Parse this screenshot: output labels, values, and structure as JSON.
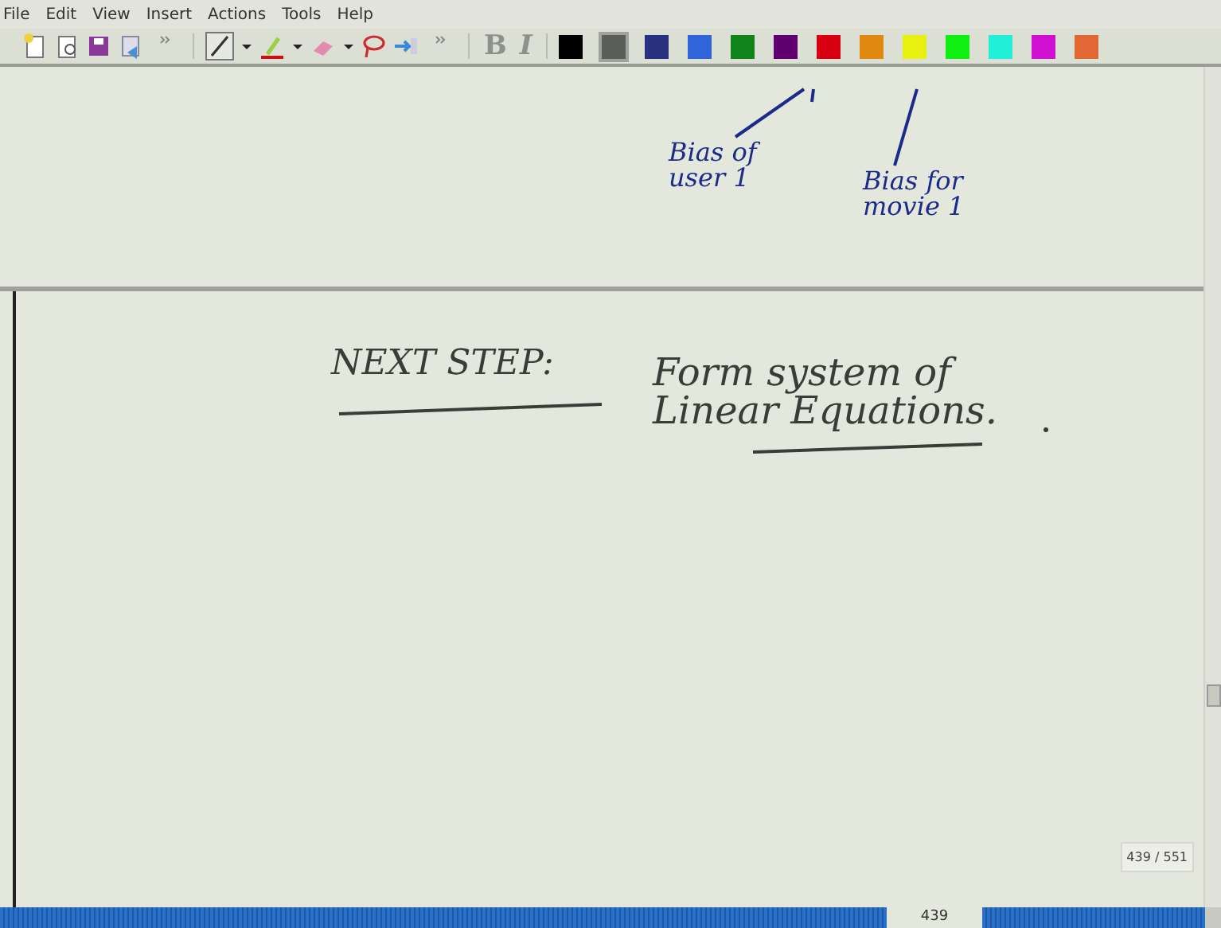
{
  "menu": [
    "File",
    "Edit",
    "View",
    "Insert",
    "Actions",
    "Tools",
    "Help"
  ],
  "format_buttons": [
    {
      "label": "B",
      "disabled": true
    },
    {
      "label": "I",
      "disabled": true
    }
  ],
  "palette": [
    {
      "color": "#000000",
      "selected": false
    },
    {
      "color": "#5c5e5a",
      "selected": true
    },
    {
      "color": "#283080",
      "selected": false
    },
    {
      "color": "#3064d8",
      "selected": false
    },
    {
      "color": "#108418",
      "selected": false
    },
    {
      "color": "#600070",
      "selected": false
    },
    {
      "color": "#d80010",
      "selected": false
    },
    {
      "color": "#e08810",
      "selected": false
    },
    {
      "color": "#e8f010",
      "selected": false
    },
    {
      "color": "#10f010",
      "selected": false
    },
    {
      "color": "#20f0d8",
      "selected": false
    },
    {
      "color": "#d010d0",
      "selected": false
    },
    {
      "color": "#e06834",
      "selected": false
    }
  ],
  "notes": [
    {
      "lines": [
        "Bias of",
        "user 1"
      ],
      "color": "#1c2a8c"
    },
    {
      "lines": [
        "Bias for",
        "movie 1"
      ],
      "color": "#1c2a8c"
    },
    {
      "lines": [
        "NEXT STEP:"
      ],
      "color": "#3a3c38"
    },
    {
      "lines": [
        "Form system of",
        "Linear Equations."
      ],
      "color": "#3a3c38"
    }
  ],
  "page_indicator": "439 / 551",
  "page_number": "439"
}
